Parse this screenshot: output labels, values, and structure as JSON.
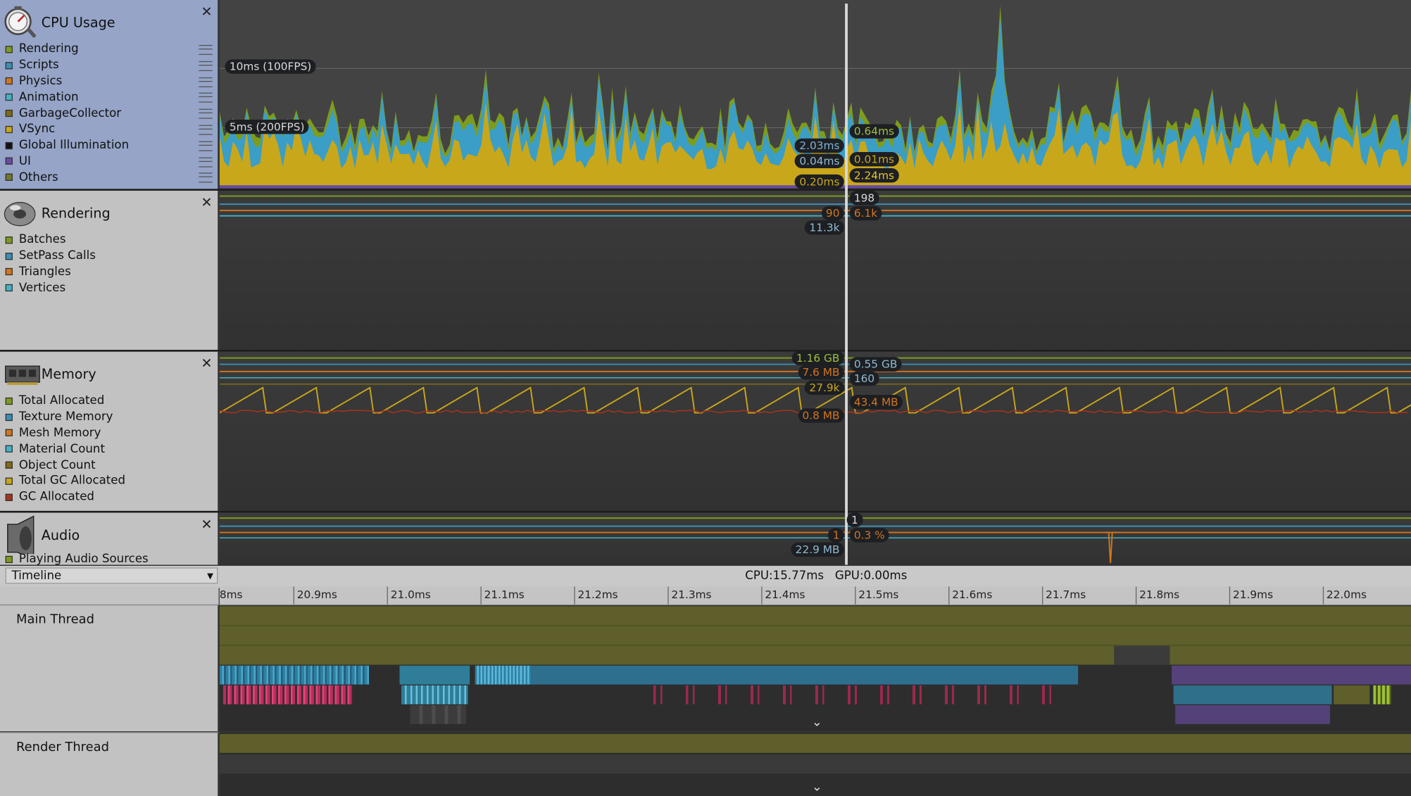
{
  "modules": [
    {
      "title": "CPU Usage",
      "legend": [
        {
          "label": "Rendering",
          "color": "#7e9c1c"
        },
        {
          "label": "Scripts",
          "color": "#3a8fb6"
        },
        {
          "label": "Physics",
          "color": "#d1761f"
        },
        {
          "label": "Animation",
          "color": "#44b3c7"
        },
        {
          "label": "GarbageCollector",
          "color": "#7f6a18"
        },
        {
          "label": "VSync",
          "color": "#c9a71a"
        },
        {
          "label": "Global Illumination",
          "color": "#111111"
        },
        {
          "label": "UI",
          "color": "#6b4aa3"
        },
        {
          "label": "Others",
          "color": "#6f7a28"
        }
      ],
      "axis_labels": [
        "10ms (100FPS)",
        "5ms (200FPS)"
      ],
      "readouts_left": [
        "2.03ms",
        "0.04ms",
        "0.20ms"
      ],
      "readouts_right": [
        "0.64ms",
        "0.01ms",
        "2.24ms"
      ]
    },
    {
      "title": "Rendering",
      "legend": [
        {
          "label": "Batches",
          "color": "#7e9c1c"
        },
        {
          "label": "SetPass Calls",
          "color": "#3a8fb6"
        },
        {
          "label": "Triangles",
          "color": "#d1761f"
        },
        {
          "label": "Vertices",
          "color": "#44b3c7"
        }
      ],
      "readouts_left": [
        "90",
        "11.3k"
      ],
      "readouts_right": [
        "198",
        "6.1k"
      ]
    },
    {
      "title": "Memory",
      "legend": [
        {
          "label": "Total Allocated",
          "color": "#7e9c1c"
        },
        {
          "label": "Texture Memory",
          "color": "#3a8fb6"
        },
        {
          "label": "Mesh Memory",
          "color": "#d1761f"
        },
        {
          "label": "Material Count",
          "color": "#44b3c7"
        },
        {
          "label": "Object Count",
          "color": "#7f6a18"
        },
        {
          "label": "Total GC Allocated",
          "color": "#c9a71a"
        },
        {
          "label": "GC Allocated",
          "color": "#a8331d"
        }
      ],
      "readouts_left": [
        "1.16 GB",
        "7.6 MB",
        "27.9k",
        "0.8 MB"
      ],
      "readouts_right": [
        "0.55 GB",
        "160",
        "43.4 MB"
      ]
    },
    {
      "title": "Audio",
      "legend": [
        {
          "label": "Playing Audio Sources",
          "color": "#7e9c1c"
        }
      ],
      "readouts_left": [
        "1",
        "22.9 MB"
      ],
      "readouts_right": [
        "1",
        "0.3 %"
      ]
    }
  ],
  "timeline": {
    "view_mode": "Timeline",
    "stats": "CPU:15.77ms   GPU:0.00ms",
    "ruler": [
      "8ms",
      "20.9ms",
      "21.0ms",
      "21.1ms",
      "21.2ms",
      "21.3ms",
      "21.4ms",
      "21.5ms",
      "21.6ms",
      "21.7ms",
      "21.8ms",
      "21.9ms",
      "22.0ms"
    ],
    "threads": [
      "Main Thread",
      "Render Thread"
    ]
  }
}
